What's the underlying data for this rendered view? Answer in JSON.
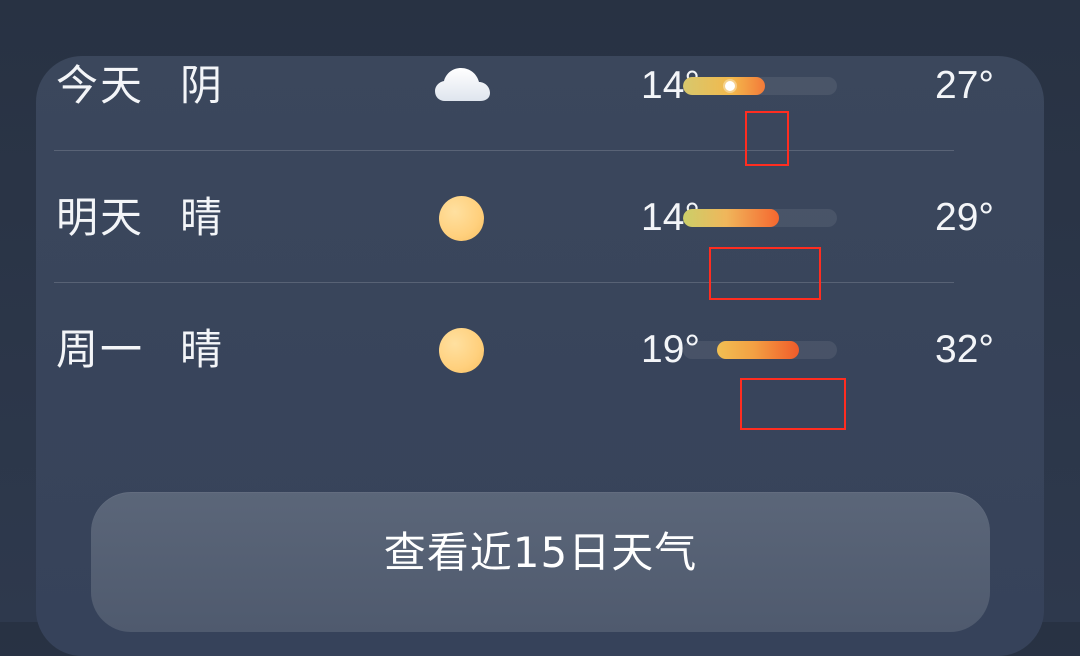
{
  "forecast": {
    "days": [
      {
        "day_label": "今天",
        "condition_label": "阴",
        "icon": "cloud-icon",
        "low": "14°",
        "high": "27°"
      },
      {
        "day_label": "明天",
        "condition_label": "晴",
        "icon": "sun-icon",
        "low": "14°",
        "high": "29°"
      },
      {
        "day_label": "周一",
        "condition_label": "晴",
        "icon": "sun-icon",
        "low": "19°",
        "high": "32°"
      }
    ]
  },
  "button": {
    "label": "查看近15日天气"
  },
  "colors": {
    "background": "#283243",
    "card": "#3b475c",
    "button": "#566175",
    "highlight_box": "#ff2d20",
    "sun": "#ffd07d",
    "range_start": "#d7c86d",
    "range_end": "#f05b2a"
  }
}
